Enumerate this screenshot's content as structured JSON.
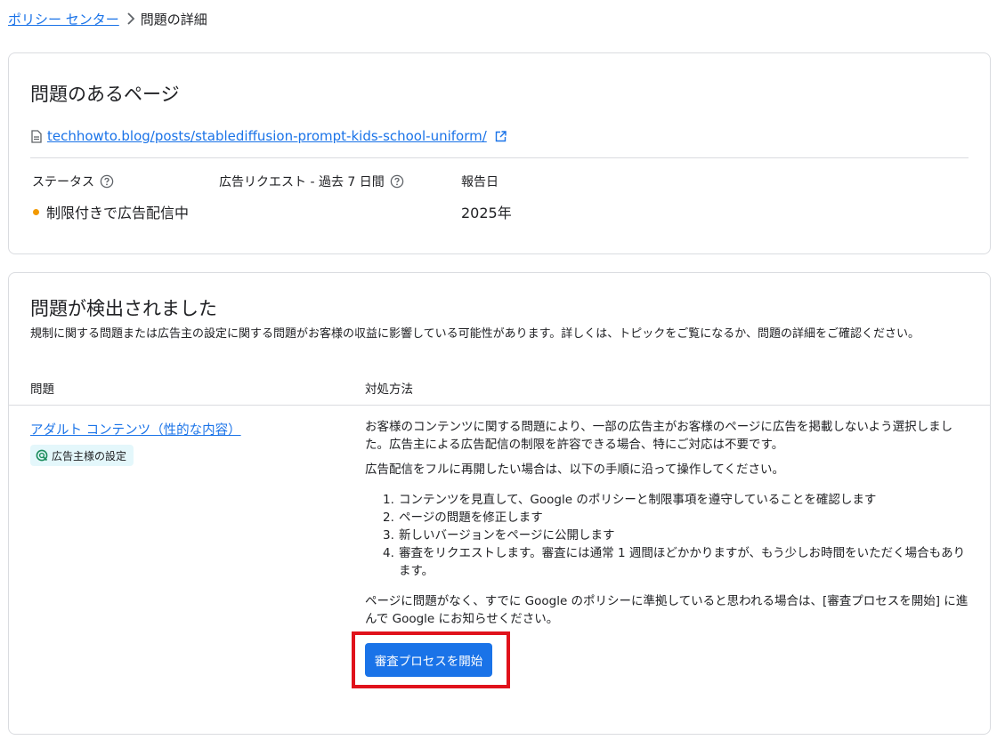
{
  "breadcrumb": {
    "parent": "ポリシー センター",
    "current": "問題の詳細"
  },
  "page_card": {
    "title": "問題のあるページ",
    "url": "techhowto.blog/posts/stablediffusion-prompt-kids-school-uniform/",
    "status_label": "ステータス",
    "status_value": "制限付きで広告配信中",
    "status_color": "#f29900",
    "requests_label": "広告リクエスト - 過去 7 日間",
    "requests_value": "",
    "report_date_label": "報告日",
    "report_date_value": "2025年"
  },
  "issues_card": {
    "title": "問題が検出されました",
    "description": "規制に関する問題または広告主の設定に関する問題がお客様の収益に影響している可能性があります。詳しくは、トピックをご覧になるか、問題の詳細をご確認ください。",
    "col_issue": "問題",
    "col_resolution": "対処方法",
    "issue_name": "アダルト コンテンツ（性的な内容）",
    "chip_label": "広告主様の設定",
    "resolution_p1": "お客様のコンテンツに関する問題により、一部の広告主がお客様のページに広告を掲載しないよう選択しました。広告主による広告配信の制限を許容できる場合、特にご対応は不要です。",
    "resolution_p2": "広告配信をフルに再開したい場合は、以下の手順に沿って操作してください。",
    "steps": [
      {
        "num": "1.",
        "text": "コンテンツを見直して、Google のポリシーと制限事項を遵守していることを確認します"
      },
      {
        "num": "2.",
        "text": "ページの問題を修正します"
      },
      {
        "num": "3.",
        "text": "新しいバージョンをページに公開します"
      },
      {
        "num": "4.",
        "text": "審査をリクエストします。審査には通常 1 週間ほどかかりますが、もう少しお時間をいただく場合もあります。"
      }
    ],
    "resolution_p3": "ページに問題がなく、すでに Google のポリシーに準拠していると思われる場合は、[審査プロセスを開始] に進んで Google にお知らせください。",
    "button_label": "審査プロセスを開始"
  },
  "colors": {
    "link": "#1a73e8",
    "button": "#1a73e8",
    "highlight_border": "#e0121b",
    "chip_bg": "#e4f7fb"
  },
  "icons": [
    "chevron-right-icon",
    "document-icon",
    "external-link-icon",
    "help-icon",
    "advertiser-settings-icon"
  ]
}
